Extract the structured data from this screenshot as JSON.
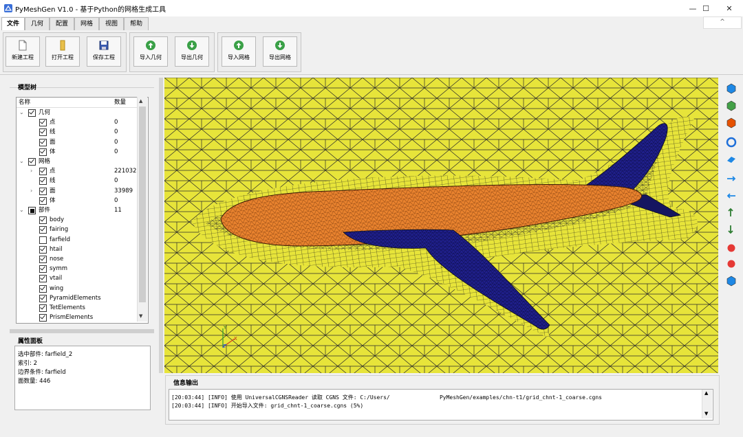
{
  "window": {
    "title": "PyMeshGen V1.0 - 基于Python的网格生成工具",
    "minimize": "—",
    "maximize": "☐",
    "close": "✕"
  },
  "menu_tabs": [
    "文件",
    "几何",
    "配置",
    "网格",
    "视图",
    "帮助"
  ],
  "collapse_ribbon": "^",
  "ribbon": {
    "buttons": [
      {
        "label": "新建工程",
        "icon": "new-file-icon"
      },
      {
        "label": "打开工程",
        "icon": "open-folder-icon"
      },
      {
        "label": "保存工程",
        "icon": "save-icon"
      },
      {
        "label": "导入几何",
        "icon": "import-up-arrow-icon"
      },
      {
        "label": "导出几何",
        "icon": "export-down-arrow-icon"
      },
      {
        "label": "导入网格",
        "icon": "import-up-arrow-icon"
      },
      {
        "label": "导出网格",
        "icon": "export-down-arrow-icon"
      }
    ]
  },
  "model_tree": {
    "title": "模型树",
    "headers": {
      "name": "名称",
      "count": "数量"
    },
    "rows": [
      {
        "name": "几何",
        "count": "",
        "level": 0,
        "expand": "v",
        "check": "on"
      },
      {
        "name": "点",
        "count": "0",
        "level": 1,
        "expand": "",
        "check": "on"
      },
      {
        "name": "线",
        "count": "0",
        "level": 1,
        "expand": "",
        "check": "on"
      },
      {
        "name": "面",
        "count": "0",
        "level": 1,
        "expand": "",
        "check": "on"
      },
      {
        "name": "体",
        "count": "0",
        "level": 1,
        "expand": "",
        "check": "on"
      },
      {
        "name": "网格",
        "count": "",
        "level": 0,
        "expand": "v",
        "check": "on"
      },
      {
        "name": "点",
        "count": "221032",
        "level": 1,
        "expand": ">",
        "check": "on"
      },
      {
        "name": "线",
        "count": "0",
        "level": 1,
        "expand": "",
        "check": "on"
      },
      {
        "name": "面",
        "count": "33989",
        "level": 1,
        "expand": ">",
        "check": "on"
      },
      {
        "name": "体",
        "count": "0",
        "level": 1,
        "expand": "",
        "check": "on"
      },
      {
        "name": "部件",
        "count": "11",
        "level": 0,
        "expand": "v",
        "check": "part"
      },
      {
        "name": "body",
        "count": "",
        "level": 1,
        "expand": "",
        "check": "on"
      },
      {
        "name": "fairing",
        "count": "",
        "level": 1,
        "expand": "",
        "check": "on"
      },
      {
        "name": "farfield",
        "count": "",
        "level": 1,
        "expand": "",
        "check": "off"
      },
      {
        "name": "htail",
        "count": "",
        "level": 1,
        "expand": "",
        "check": "on"
      },
      {
        "name": "nose",
        "count": "",
        "level": 1,
        "expand": "",
        "check": "on"
      },
      {
        "name": "symm",
        "count": "",
        "level": 1,
        "expand": "",
        "check": "on"
      },
      {
        "name": "vtail",
        "count": "",
        "level": 1,
        "expand": "",
        "check": "on"
      },
      {
        "name": "wing",
        "count": "",
        "level": 1,
        "expand": "",
        "check": "on"
      },
      {
        "name": "PyramidElements",
        "count": "",
        "level": 1,
        "expand": "",
        "check": "on"
      },
      {
        "name": "TetElements",
        "count": "",
        "level": 1,
        "expand": "",
        "check": "on"
      },
      {
        "name": "PrismElements",
        "count": "",
        "level": 1,
        "expand": "",
        "check": "on"
      }
    ]
  },
  "properties": {
    "title": "属性面板",
    "lines": [
      "选中部件: farfield_2",
      "索引: 2",
      "边界条件: farfield",
      "面数量: 446"
    ]
  },
  "axes": {
    "x": "X",
    "y": "Y",
    "z": "Z"
  },
  "right_toolbar": [
    {
      "icon": "cube-front-view-icon",
      "color": "#1e88e5"
    },
    {
      "icon": "cube-side-view-icon",
      "color": "#43a047"
    },
    {
      "icon": "cube-top-view-icon",
      "color": "#e65100"
    },
    {
      "icon": "reset-view-icon",
      "color": "#1e6fd9"
    },
    {
      "icon": "fit-view-icon",
      "color": "#1e88e5"
    },
    {
      "icon": "x-plus-axis-icon",
      "color": "#1e88e5"
    },
    {
      "icon": "x-minus-axis-icon",
      "color": "#1e88e5"
    },
    {
      "icon": "y-plus-axis-icon",
      "color": "#2e7d32"
    },
    {
      "icon": "y-minus-axis-icon",
      "color": "#2e7d32"
    },
    {
      "icon": "z-plus-axis-icon",
      "color": "#e53935"
    },
    {
      "icon": "z-minus-axis-icon",
      "color": "#e53935"
    },
    {
      "icon": "isometric-view-icon",
      "color": "#1e88e5"
    }
  ],
  "log": {
    "title": "信息输出",
    "lines": [
      "[20:03:44] [INFO] 使用 UniversalCGNSReader 读取 CGNS 文件: C:/Users/               PyMeshGen/examples/chn-t1/grid_chnt-1_coarse.cgns",
      "[20:03:44] [INFO] 开始导入文件: grid_chnt-1_coarse.cgns (5%)"
    ]
  },
  "colors": {
    "viewport_bg": "#e7e43a",
    "fuselage": "#e8822e",
    "wing": "#1f1f8a",
    "mesh_lines": "#222222"
  }
}
